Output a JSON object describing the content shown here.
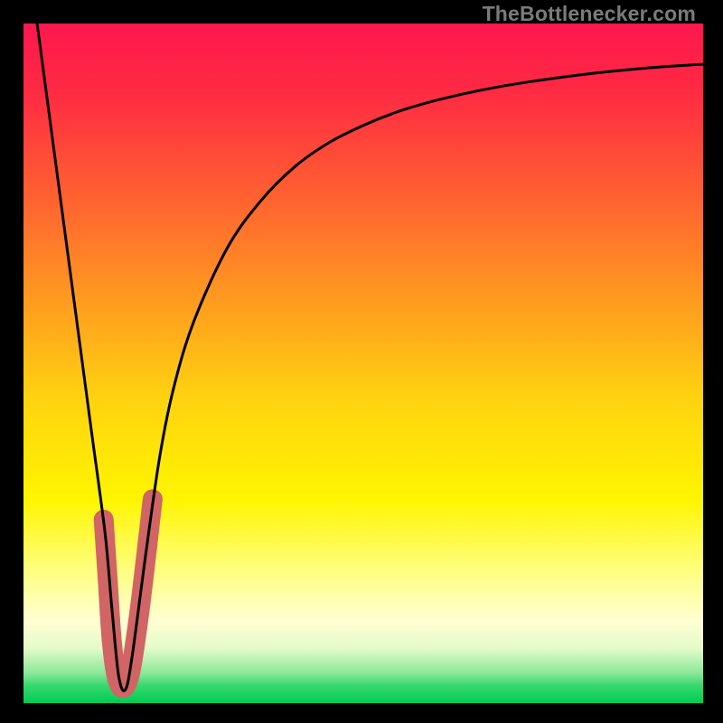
{
  "watermark": "TheBottlenecker.com",
  "chart_data": {
    "type": "line",
    "title": "",
    "xlabel": "",
    "ylabel": "",
    "xlim": [
      0,
      100
    ],
    "ylim": [
      0,
      100
    ],
    "gradient_stops": [
      {
        "offset": 0.0,
        "color": "#ff174e"
      },
      {
        "offset": 0.1,
        "color": "#ff2a43"
      },
      {
        "offset": 0.25,
        "color": "#ff5f31"
      },
      {
        "offset": 0.4,
        "color": "#ff9820"
      },
      {
        "offset": 0.55,
        "color": "#ffd210"
      },
      {
        "offset": 0.7,
        "color": "#fff500"
      },
      {
        "offset": 0.8,
        "color": "#fffe7a"
      },
      {
        "offset": 0.88,
        "color": "#ffffd3"
      },
      {
        "offset": 0.92,
        "color": "#e3fac9"
      },
      {
        "offset": 0.955,
        "color": "#8de89b"
      },
      {
        "offset": 0.975,
        "color": "#35d76c"
      },
      {
        "offset": 1.0,
        "color": "#00cd54"
      }
    ],
    "series": [
      {
        "name": "bottleneck-curve",
        "color": "#000000",
        "x": [
          2,
          4,
          6,
          8,
          10,
          12,
          13,
          14,
          15,
          16,
          18,
          20,
          22,
          25,
          30,
          35,
          40,
          45,
          50,
          55,
          60,
          65,
          70,
          75,
          80,
          85,
          90,
          95,
          100
        ],
        "y": [
          100,
          85,
          70,
          55,
          40,
          25,
          14,
          4,
          2,
          7,
          22,
          36,
          46,
          56,
          67,
          74,
          79,
          82.5,
          85,
          87,
          88.5,
          89.7,
          90.7,
          91.5,
          92.2,
          92.8,
          93.3,
          93.7,
          94
        ]
      }
    ],
    "highlight": {
      "name": "highlight-segment",
      "color": "#d16464",
      "approx_x_range": [
        11.5,
        19
      ],
      "approx_y_range": [
        2,
        30
      ]
    }
  }
}
